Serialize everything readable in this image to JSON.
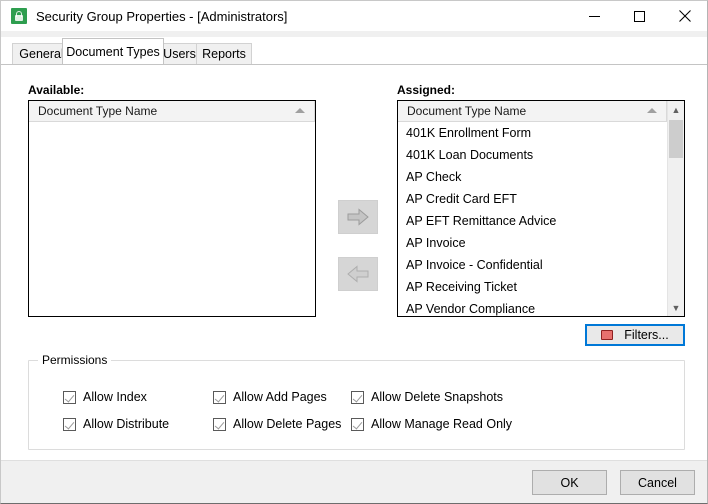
{
  "window": {
    "title": "Security Group Properties - [Administrators]",
    "icon": "security-group-lock-icon",
    "controls": {
      "minimize": "minimize-icon",
      "maximize": "maximize-icon",
      "close": "close-icon"
    }
  },
  "tabs": [
    {
      "label": "General",
      "active": false
    },
    {
      "label": "Document Types",
      "active": true
    },
    {
      "label": "Users",
      "active": false
    },
    {
      "label": "Reports",
      "active": false
    }
  ],
  "available": {
    "label": "Available:",
    "column_header": "Document Type Name",
    "sort_indicator": "sort-ascending-icon",
    "items": []
  },
  "assigned": {
    "label": "Assigned:",
    "column_header": "Document Type Name",
    "sort_indicator": "sort-ascending-icon",
    "items": [
      "401K Enrollment Form",
      "401K Loan Documents",
      "AP Check",
      "AP Credit Card EFT",
      "AP EFT Remittance Advice",
      "AP Invoice",
      "AP Invoice - Confidential",
      "AP Receiving Ticket",
      "AP Vendor Compliance"
    ],
    "scrollbar": {
      "up_arrow": "chevron-up-icon",
      "down_arrow": "chevron-down-icon"
    }
  },
  "transfer": {
    "assign_label": "arrow-right-icon",
    "unassign_label": "arrow-left-icon"
  },
  "filters": {
    "label": "Filters...",
    "icon": "filter-icon",
    "focused": true
  },
  "permissions": {
    "legend": "Permissions",
    "checkboxes": [
      {
        "label": "Allow Index",
        "checked": true
      },
      {
        "label": "Allow Distribute",
        "checked": true
      },
      {
        "label": "Allow Add Pages",
        "checked": true
      },
      {
        "label": "Allow Delete Pages",
        "checked": true
      },
      {
        "label": "Allow Delete Snapshots",
        "checked": true
      },
      {
        "label": "Allow Manage Read Only",
        "checked": true
      }
    ]
  },
  "footer": {
    "ok_label": "OK",
    "cancel_label": "Cancel"
  },
  "colors": {
    "accent_focus": "#0078d7",
    "app_icon": "#2e9e4f",
    "filter_icon": "#e8706e",
    "dialog_bg": "#f0f0f0",
    "pane_bg": "#ffffff"
  }
}
